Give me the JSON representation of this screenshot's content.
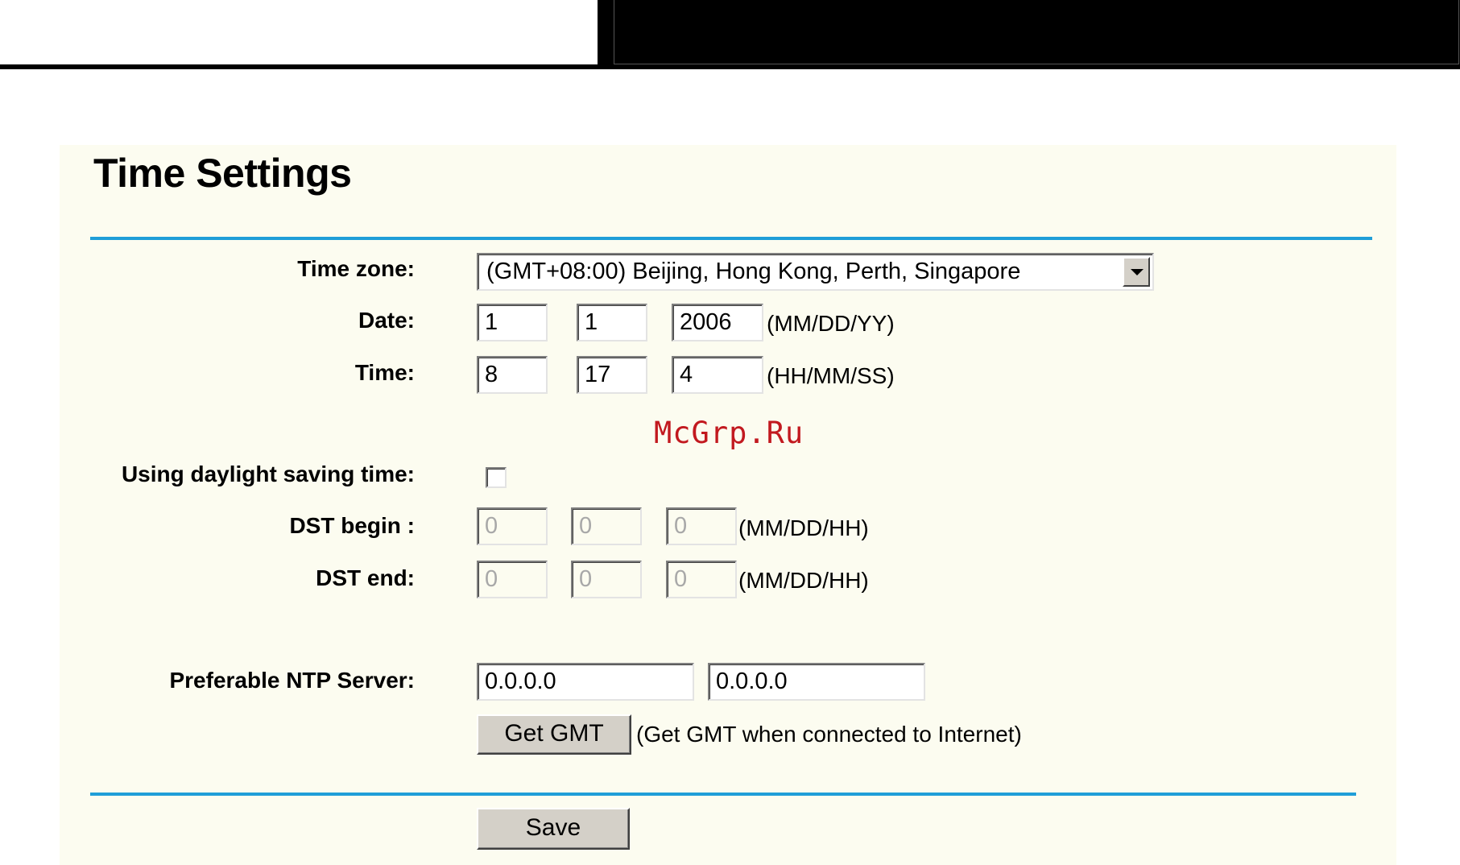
{
  "page": {
    "title": "Time Settings",
    "watermark": "McGrp.Ru"
  },
  "timezone": {
    "label": "Time zone:",
    "selected": "(GMT+08:00) Beijing, Hong Kong, Perth, Singapore"
  },
  "date": {
    "label": "Date:",
    "month": "1",
    "day": "1",
    "year": "2006",
    "format": "(MM/DD/YY)"
  },
  "time": {
    "label": "Time:",
    "hour": "8",
    "minute": "17",
    "second": "4",
    "format": "(HH/MM/SS)"
  },
  "dst": {
    "label": "Using daylight saving time:",
    "checked": false,
    "begin": {
      "label": "DST begin :",
      "month": "0",
      "day": "0",
      "hour": "0",
      "format": "(MM/DD/HH)"
    },
    "end": {
      "label": "DST end:",
      "month": "0",
      "day": "0",
      "hour": "0",
      "format": "(MM/DD/HH)"
    }
  },
  "ntp": {
    "label": "Preferable NTP Server:",
    "server1": "0.0.0.0",
    "server2": "0.0.0.0",
    "get_gmt_label": "Get GMT",
    "get_gmt_hint": "(Get GMT when connected to Internet)"
  },
  "actions": {
    "save_label": "Save"
  },
  "colors": {
    "panel_bg": "#fcfcf0",
    "rule": "#1f9ed8",
    "watermark": "#c2191f"
  }
}
